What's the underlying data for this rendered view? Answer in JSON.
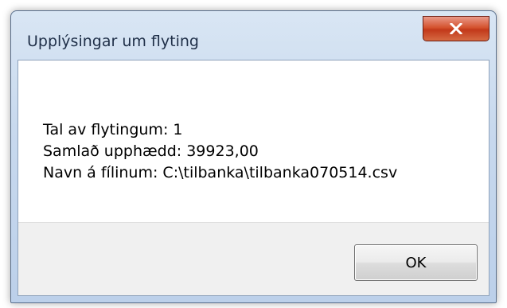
{
  "window": {
    "title": "Upplýsingar um flyting",
    "close_icon": "close-icon"
  },
  "message": {
    "lines": [
      "Tal av flytingum: 1",
      "Samlað upphædd: 39923,00",
      "Navn á fílinum: C:\\tilbanka\\tilbanka070514.csv"
    ]
  },
  "buttons": {
    "ok_label": "OK"
  },
  "colors": {
    "close_button": "#c2391a",
    "title_bar": "#c8d9ee",
    "footer": "#f0f0f0"
  }
}
